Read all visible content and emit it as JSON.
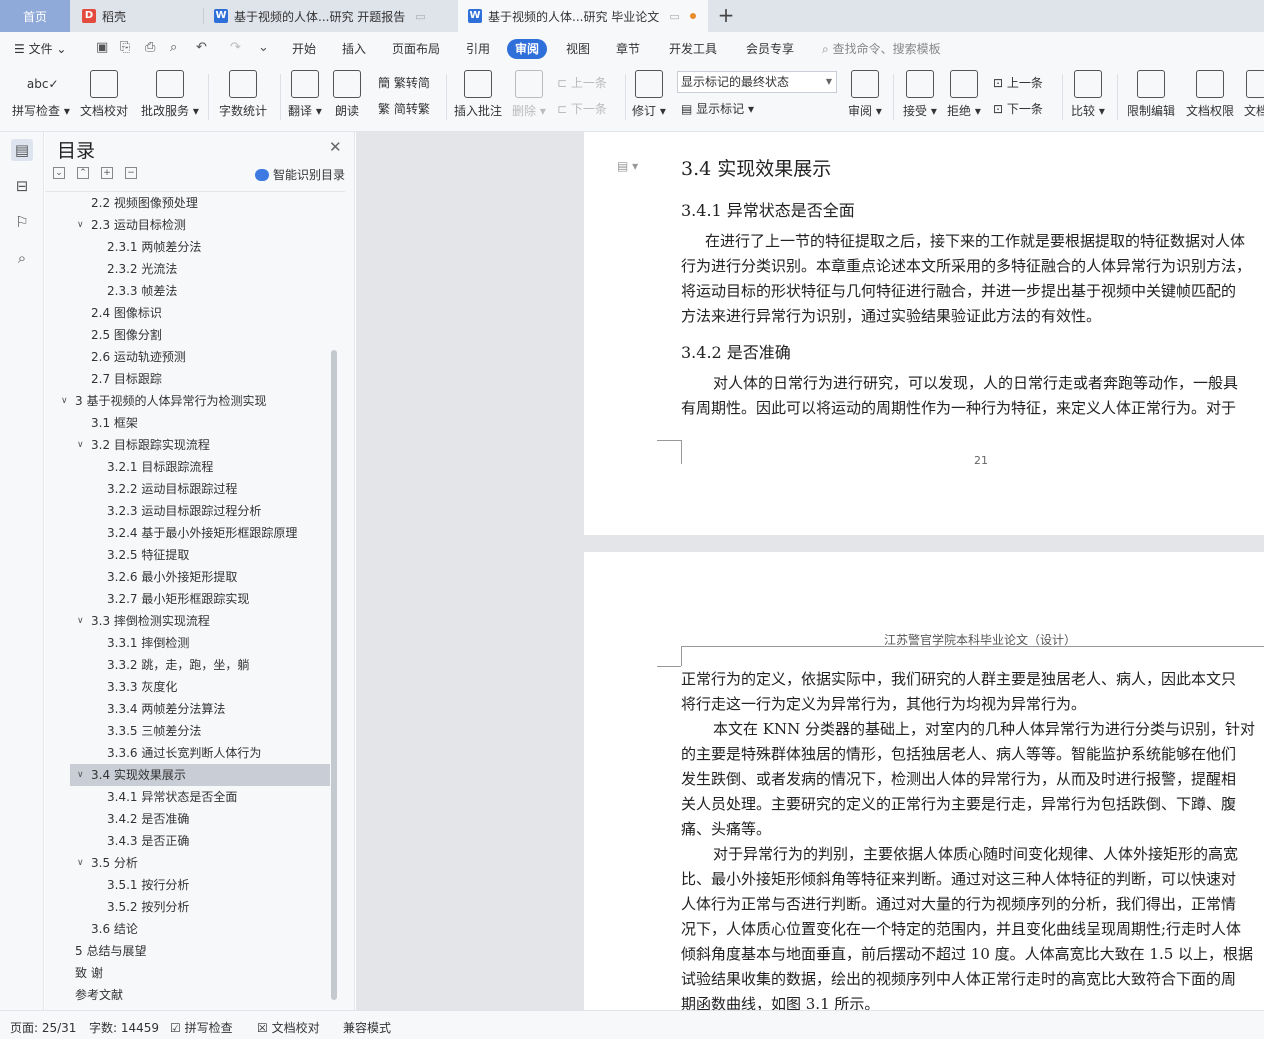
{
  "tabs": {
    "home": "首页",
    "daoke": "稻壳",
    "doc1": "基于视频的人体...研究 开题报告",
    "doc2": "基于视频的人体...研究 毕业论文",
    "add": "+"
  },
  "menu": {
    "file": "文件",
    "items": [
      "开始",
      "插入",
      "页面布局",
      "引用",
      "审阅",
      "视图",
      "章节",
      "开发工具",
      "会员专享"
    ],
    "active": "审阅",
    "search": "查找命令、搜索模板"
  },
  "ribbon": {
    "spell": "拼写检查",
    "proofread": "文档校对",
    "review_service": "批改服务",
    "word_count": "字数统计",
    "translate": "翻译",
    "read_aloud": "朗读",
    "trad": "繁转简",
    "simp": "简转繁",
    "insert_comment": "插入批注",
    "delete": "删除",
    "prev": "上一条",
    "next": "下一条",
    "track": "修订",
    "markup_state": "显示标记的最终状态",
    "show_markup": "显示标记",
    "review": "审阅",
    "accept": "接受",
    "reject": "拒绝",
    "prev2": "上一条",
    "next2": "下一条",
    "compare": "比较",
    "restrict": "限制编辑",
    "permission": "文档权限",
    "more": "文档"
  },
  "toc": {
    "title": "目录",
    "ai_button": "智能识别目录",
    "items": [
      {
        "text": "2.2  视频图像预处理",
        "level": 2
      },
      {
        "text": "2.3  运动目标检测",
        "level": 2,
        "expanded": true
      },
      {
        "text": "2.3.1  两帧差分法",
        "level": 3
      },
      {
        "text": "2.3.2  光流法",
        "level": 3
      },
      {
        "text": "2.3.3  帧差法",
        "level": 3
      },
      {
        "text": "2.4  图像标识",
        "level": 2
      },
      {
        "text": "2.5  图像分割",
        "level": 2
      },
      {
        "text": "2.6  运动轨迹预测",
        "level": 2
      },
      {
        "text": "2.7  目标跟踪",
        "level": 2
      },
      {
        "text": "3  基于视频的人体异常行为检测实现",
        "level": 1,
        "expanded": true
      },
      {
        "text": "3.1  框架",
        "level": 2
      },
      {
        "text": "3.2  目标跟踪实现流程",
        "level": 2,
        "expanded": true
      },
      {
        "text": "3.2.1 目标跟踪流程",
        "level": 3
      },
      {
        "text": "3.2.2  运动目标跟踪过程",
        "level": 3
      },
      {
        "text": "3.2.3  运动目标跟踪过程分析",
        "level": 3
      },
      {
        "text": "3.2.4 基于最小外接矩形框跟踪原理",
        "level": 3
      },
      {
        "text": "3.2.5 特征提取",
        "level": 3
      },
      {
        "text": "3.2.6  最小外接矩形提取",
        "level": 3
      },
      {
        "text": "3.2.7 最小矩形框跟踪实现",
        "level": 3
      },
      {
        "text": "3.3  摔倒检测实现流程",
        "level": 2,
        "expanded": true
      },
      {
        "text": "3.3.1 摔倒检测",
        "level": 3
      },
      {
        "text": "3.3.2  跳，走，跑，坐，躺",
        "level": 3
      },
      {
        "text": "3.3.3  灰度化",
        "level": 3
      },
      {
        "text": "3.3.4  两帧差分法算法",
        "level": 3
      },
      {
        "text": "3.3.5  三帧差分法",
        "level": 3
      },
      {
        "text": "3.3.6  通过长宽判断人体行为",
        "level": 3
      },
      {
        "text": "3.4 实现效果展示",
        "level": 2,
        "expanded": true,
        "selected": true
      },
      {
        "text": "3.4.1 异常状态是否全面",
        "level": 3
      },
      {
        "text": "3.4.2  是否准确",
        "level": 3
      },
      {
        "text": "3.4.3 是否正确",
        "level": 3
      },
      {
        "text": "3.5  分析",
        "level": 2,
        "expanded": true
      },
      {
        "text": "3.5.1  按行分析",
        "level": 3
      },
      {
        "text": "3.5.2  按列分析",
        "level": 3
      },
      {
        "text": "3.6 结论",
        "level": 2
      },
      {
        "text": "5  总结与展望",
        "level": 1
      },
      {
        "text": "致    谢",
        "level": 1
      },
      {
        "text": "参考文献",
        "level": 1
      }
    ]
  },
  "page1": {
    "h2": "3.4 实现效果展示",
    "h3a": "3.4.1 异常状态是否全面",
    "p1": [
      "在进行了上一节的特征提取之后，接下来的工作就是要根据提取的特征数据对人体",
      "行为进行分类识别。本章重点论述本文所采用的多特征融合的人体异常行为识别方法，",
      "将运动目标的形状特征与几何特征进行融合，并进一步提出基于视频中关键帧匹配的",
      "方法来进行异常行为识别，通过实验结果验证此方法的有效性。"
    ],
    "h3b": "3.4.2  是否准确",
    "p2": [
      "对人体的日常行为进行研究，可以发现，人的日常行走或者奔跑等动作，一般具",
      "有周期性。因此可以将运动的周期性作为一种行为特征，来定义人体正常行为。对于"
    ],
    "page_number": "21"
  },
  "page2": {
    "header": "江苏警官学院本科毕业论文（设计）",
    "lines": [
      "正常行为的定义，依据实际中，我们研究的人群主要是独居老人、病人，因此本文只",
      "将行走这一行为定义为异常行为，其他行为均视为异常行为。",
      "本文在 KNN 分类器的基础上，对室内的几种人体异常行为进行分类与识别，针对",
      "的主要是特殊群体独居的情形，包括独居老人、病人等等。智能监护系统能够在他们",
      "发生跌倒、或者发病的情况下，检测出人体的异常行为，从而及时进行报警，提醒相",
      "关人员处理。主要研究的定义的正常行为主要是行走，异常行为包括跌倒、下蹲、腹",
      "痛、头痛等。",
      "对于异常行为的判别，主要依据人体质心随时间变化规律、人体外接矩形的高宽",
      "比、最小外接矩形倾斜角等特征来判断。通过对这三种人体特征的判断，可以快速对",
      "人体行为正常与否进行判断。通过对大量的行为视频序列的分析，我们得出，正常情",
      "况下，人体质心位置变化在一个特定的范围内，并且变化曲线呈现周期性;行走时人体",
      "倾斜角度基本与地面垂直，前后摆动不超过 10 度。人体高宽比大致在 1.5 以上，根据",
      "试验结果收集的数据，绘出的视频序列中人体正常行走时的高宽比大致符合下面的周",
      "期函数曲线，如图 3.1 所示。"
    ]
  },
  "status": {
    "page": "页面: 25/31",
    "words": "字数: 14459",
    "spell": "拼写检查",
    "proofread": "文档校对",
    "compat": "兼容模式"
  }
}
